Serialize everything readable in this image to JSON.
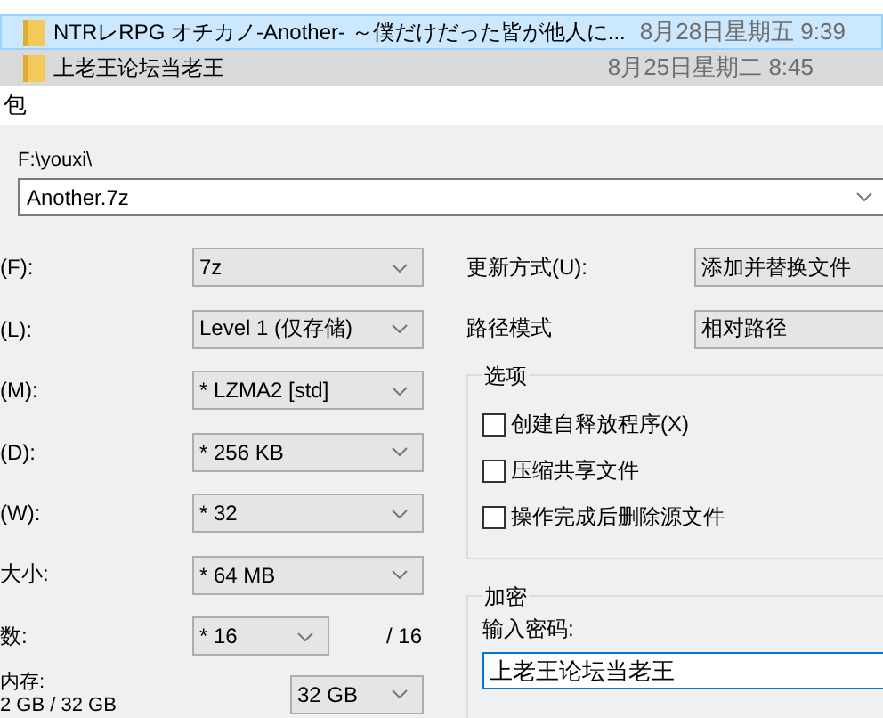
{
  "file_list": [
    {
      "name": "NTRレRPG オチカノ-Another- ～僕だけだった皆が他人に...",
      "date": "8月28日星期五 9:39",
      "selected": true,
      "hovered": false
    },
    {
      "name": "上老王论坛当老王",
      "date": "8月25日星期二 8:45",
      "selected": false,
      "hovered": true
    }
  ],
  "dialog": {
    "title": "包",
    "archive": {
      "folder": "F:\\youxi\\",
      "name": "Another.7z"
    },
    "left_fields": [
      {
        "label": "(F):",
        "value": "7z",
        "kind": "combo"
      },
      {
        "label": "(L):",
        "value": "Level 1 (仅存储)",
        "kind": "combo"
      },
      {
        "label": "(M):",
        "value": "* LZMA2 [std]",
        "kind": "combo"
      },
      {
        "label": "(D):",
        "value": "* 256 KB",
        "kind": "combo"
      },
      {
        "label": "(W):",
        "value": "* 32",
        "kind": "combo"
      },
      {
        "label": "大小:",
        "value": "* 64 MB",
        "kind": "combo"
      },
      {
        "label": "数:",
        "value": "* 16",
        "kind": "short-combo",
        "suffix": "/ 16"
      }
    ],
    "memory": {
      "label": "内存:",
      "usage": "2 GB / 32 GB",
      "value": "32 GB"
    },
    "right_fields": [
      {
        "label": "更新方式(U):",
        "value": "添加并替换文件"
      },
      {
        "label": "路径模式",
        "value": "相对路径"
      }
    ],
    "options": {
      "title": "选项",
      "items": [
        {
          "label": "创建自释放程序(X)",
          "checked": false
        },
        {
          "label": "压缩共享文件",
          "checked": false
        },
        {
          "label": "操作完成后删除源文件",
          "checked": false
        }
      ]
    },
    "encryption": {
      "title": "加密",
      "prompt": "输入密码:",
      "value": "上老王论坛当老王"
    }
  }
}
